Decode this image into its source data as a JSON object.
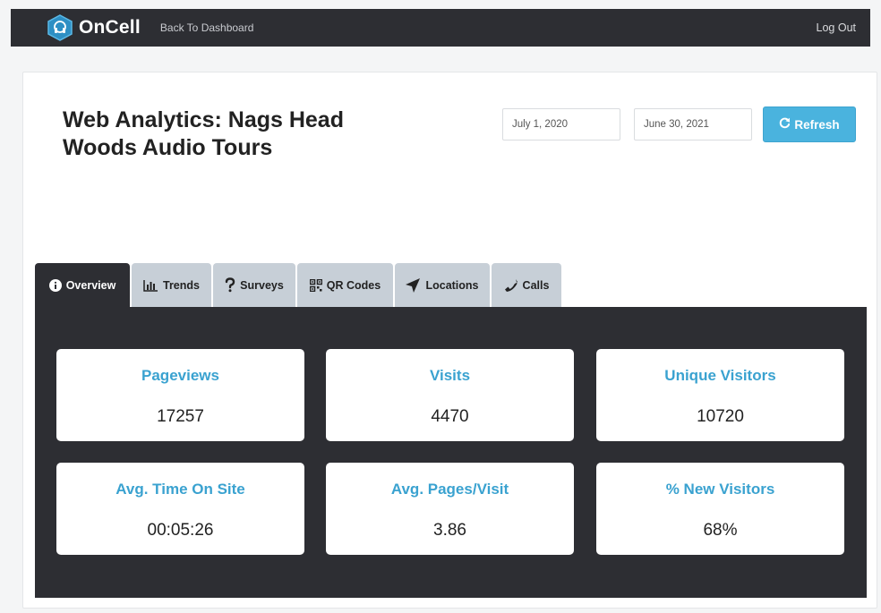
{
  "header": {
    "brand": "OnCell",
    "back_link": "Back To Dashboard",
    "logout": "Log Out",
    "brand_color": "#2d8fc4"
  },
  "page": {
    "title": "Web Analytics: Nags Head Woods Audio Tours"
  },
  "filters": {
    "start_date": "July 1, 2020",
    "end_date": "June 30, 2021",
    "refresh_label": "Refresh",
    "refresh_icon": "refresh-icon"
  },
  "tabs": [
    {
      "label": "Overview",
      "icon": "info-icon",
      "active": true
    },
    {
      "label": "Trends",
      "icon": "bar-chart-icon",
      "active": false
    },
    {
      "label": "Surveys",
      "icon": "question-icon",
      "active": false
    },
    {
      "label": "QR Codes",
      "icon": "qr-code-icon",
      "active": false
    },
    {
      "label": "Locations",
      "icon": "location-arrow-icon",
      "active": false
    },
    {
      "label": "Calls",
      "icon": "phone-icon",
      "active": false
    }
  ],
  "stats": [
    {
      "label": "Pageviews",
      "value": "17257"
    },
    {
      "label": "Visits",
      "value": "4470"
    },
    {
      "label": "Unique Visitors",
      "value": "10720"
    },
    {
      "label": "Avg. Time On Site",
      "value": "00:05:26"
    },
    {
      "label": "Avg. Pages/Visit",
      "value": "3.86"
    },
    {
      "label": "% New Visitors",
      "value": "68%"
    }
  ],
  "colors": {
    "accent": "#3aa2d0",
    "dark": "#2d2e33",
    "tab_inactive": "#c7cfd7"
  }
}
